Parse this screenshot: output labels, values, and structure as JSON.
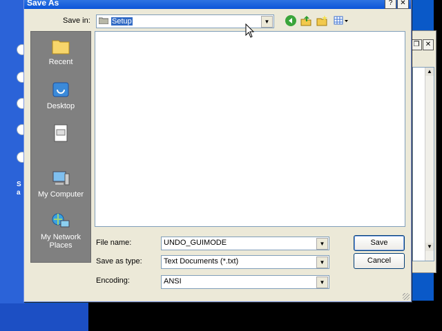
{
  "dialog": {
    "title": "Save As",
    "save_in_label": "Save in:",
    "save_in_value": "Setup",
    "file_name_label": "File name:",
    "file_name_value": "UNDO_GUIMODE",
    "save_type_label": "Save as type:",
    "save_type_value": "Text Documents (*.txt)",
    "encoding_label": "Encoding:",
    "encoding_value": "ANSI",
    "save_button": "Save",
    "cancel_button": "Cancel",
    "help_glyph": "?",
    "close_glyph": "✕"
  },
  "toolbar": {
    "icons": [
      "back-icon",
      "up-folder-icon",
      "new-folder-icon",
      "views-menu-icon"
    ]
  },
  "places": [
    {
      "label": "Recent",
      "icon": "recent-folder-icon"
    },
    {
      "label": "Desktop",
      "icon": "desktop-icon"
    },
    {
      "label": "",
      "icon": "my-documents-icon"
    },
    {
      "label": "My Computer",
      "icon": "my-computer-icon"
    },
    {
      "label": "My Network Places",
      "icon": "network-places-icon"
    }
  ],
  "background": {
    "partial_text_1": "S",
    "partial_text_2": "a",
    "back_window_restore": "❐",
    "back_window_close": "✕"
  },
  "colors": {
    "title_bar": "#0b55d8",
    "desktop": "#0a59c8",
    "dialog_face": "#ece9d8",
    "places_bar": "#808080",
    "selection": "#316ac5"
  }
}
